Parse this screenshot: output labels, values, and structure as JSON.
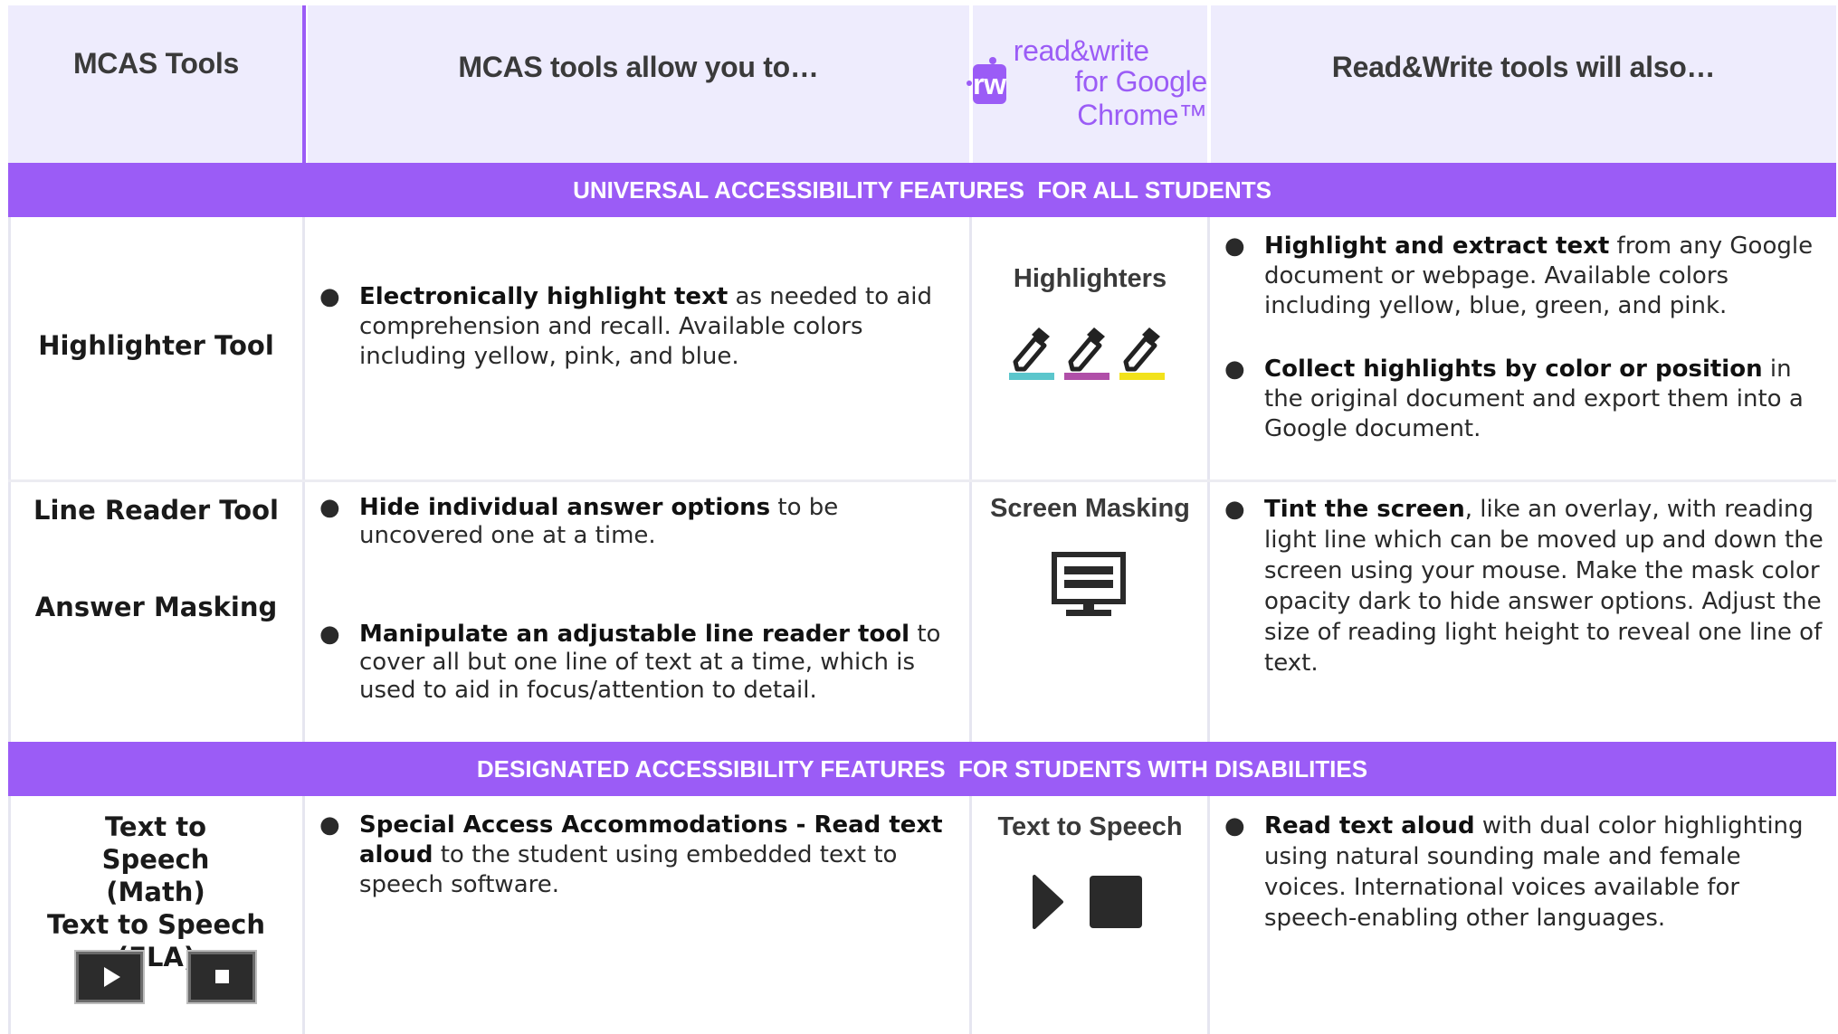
{
  "header": {
    "col1": "MCAS Tools",
    "col2": "MCAS tools allow you to…",
    "logo": {
      "mark": "rw",
      "name": "read&write",
      "sub": "for Google Chrome™"
    },
    "col4": "Read&Write tools will also…"
  },
  "bands": {
    "universal": "UNIVERSAL ACCESSIBILITY FEATURES  FOR ALL STUDENTS",
    "designated": "DESIGNATED ACCESSIBILITY FEATURES  FOR STUDENTS WITH DISABILITIES"
  },
  "rows": {
    "highlighter": {
      "tool": "Highlighter Tool",
      "mcas_bullet": {
        "bold": "Electronically highlight text",
        "rest": " as needed to aid comprehension and recall. Available colors including yellow, pink, and blue."
      },
      "rw_title": "Highlighters",
      "rw_bullets": [
        {
          "bold": "Highlight and extract text",
          "rest": " from any Google document or webpage. Available colors including yellow, blue, green, and pink."
        },
        {
          "bold": "Collect highlights by color or position",
          "rest": " in the original document  and export them into a Google document."
        }
      ],
      "colors": [
        "#5bc6cc",
        "#b04fa8",
        "#f2e21b"
      ]
    },
    "linereader": {
      "tool1": "Line Reader Tool",
      "tool2": "Answer Masking",
      "mcas_bullets": [
        {
          "bold": "Hide individual answer options",
          "rest": " to be uncovered one at a time."
        },
        {
          "bold": "Manipulate an adjustable line reader tool",
          "rest": " to cover all but one line of text at a time, which is used to aid in focus/attention to detail."
        }
      ],
      "rw_title": "Screen Masking",
      "rw_bullet": {
        "bold": "Tint the screen",
        "rest": ", like an overlay, with reading light line which can be moved up and down the screen using your mouse.  Make the mask color opacity dark to hide answer options.  Adjust the size of reading light height to reveal one line of text."
      }
    },
    "tts": {
      "tool1": "Text to Speech (Math)",
      "tool2": "Text to Speech (ELA)",
      "mcas_bullet": {
        "bold": "Special Access Accommodations - Read text aloud",
        "rest": " to the student using embedded text to speech software."
      },
      "rw_title": "Text to Speech",
      "rw_bullet": {
        "bold": "Read text aloud",
        "rest": " with dual color highlighting using natural sounding male and female voices. International voices available for speech-enabling other languages."
      }
    }
  },
  "bullet_glyph": "●"
}
